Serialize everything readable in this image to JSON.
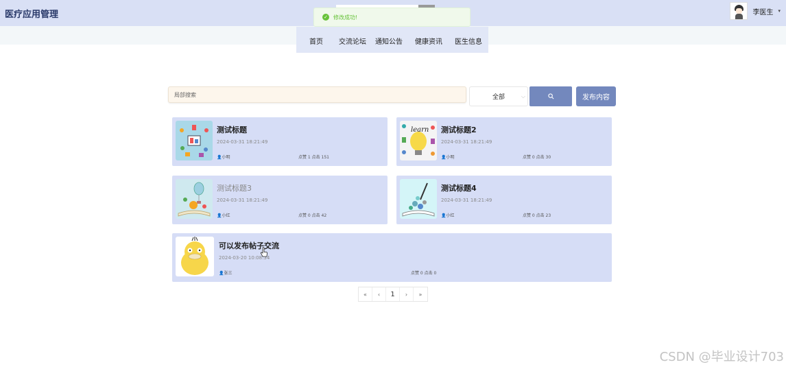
{
  "app": {
    "title": "医疗应用管理"
  },
  "user": {
    "name": "李医生",
    "caret": "▾"
  },
  "toast": {
    "message": "修改成功!"
  },
  "nav": {
    "items": [
      "首页",
      "交流论坛",
      "通知公告",
      "健康资讯",
      "医生信息"
    ]
  },
  "search": {
    "placeholder": "局部搜索",
    "filter_value": "全部",
    "publish_label": "发布内容"
  },
  "posts": [
    {
      "title": "测试标题",
      "date": "2024-03-31 18:21:49",
      "author": "小明",
      "stats": "点赞 1 点击 151",
      "thumb_icon": "medical-illustration-icon"
    },
    {
      "title": "测试标题2",
      "date": "2024-03-31 18:21:49",
      "author": "小明",
      "stats": "点赞 0 点击 30",
      "thumb_icon": "learn-bulb-icon"
    },
    {
      "title": "测试标题3",
      "date": "2024-03-31 18:21:49",
      "author": "小红",
      "stats": "点赞 0 点击 42",
      "thumb_icon": "book-balloon-icon"
    },
    {
      "title": "测试标题4",
      "date": "2024-03-31 18:21:49",
      "author": "小红",
      "stats": "点赞 0 点击 23",
      "thumb_icon": "book-pen-icon"
    },
    {
      "title": "可以发布帖子交流",
      "date": "2024-03-20 10:08:34",
      "author": "张三",
      "stats": "点赞 0 点击 0",
      "thumb_icon": "yellow-duck-icon"
    }
  ],
  "pagination": {
    "first": "«",
    "prev": "‹",
    "current": "1",
    "next": "›",
    "last": "»"
  },
  "watermark": "CSDN @毕业设计703",
  "colors": {
    "header_bg": "#d9e0f5",
    "card_bg": "#d6ddf6",
    "accent": "#7388bd",
    "success": "#67c23a"
  }
}
